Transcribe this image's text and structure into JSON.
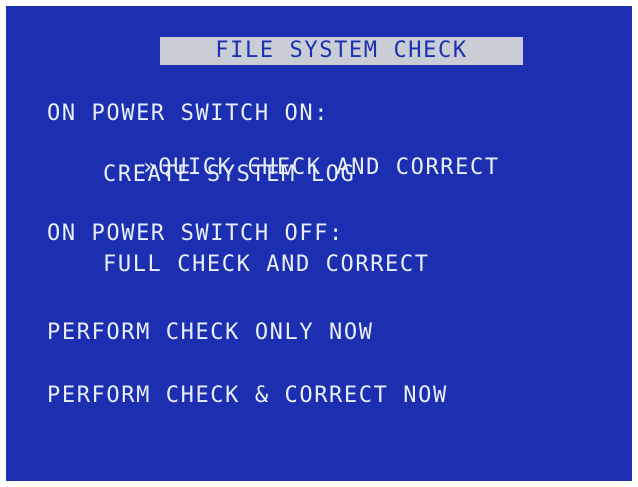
{
  "title": "FILE SYSTEM CHECK",
  "power_on": {
    "heading": "ON POWER SWITCH ON:",
    "selected_marker": "»",
    "options": [
      "QUICK CHECK AND CORRECT",
      "CREATE SYSTEM LOG"
    ]
  },
  "power_off": {
    "heading": "ON POWER SWITCH OFF:",
    "option": "FULL CHECK AND CORRECT"
  },
  "actions": {
    "check_only": "PERFORM CHECK ONLY NOW",
    "check_correct": "PERFORM CHECK & CORRECT NOW"
  },
  "colors": {
    "background": "#1b2fb0",
    "text": "#e8eefc",
    "title_bar": "#c9cdd6"
  }
}
